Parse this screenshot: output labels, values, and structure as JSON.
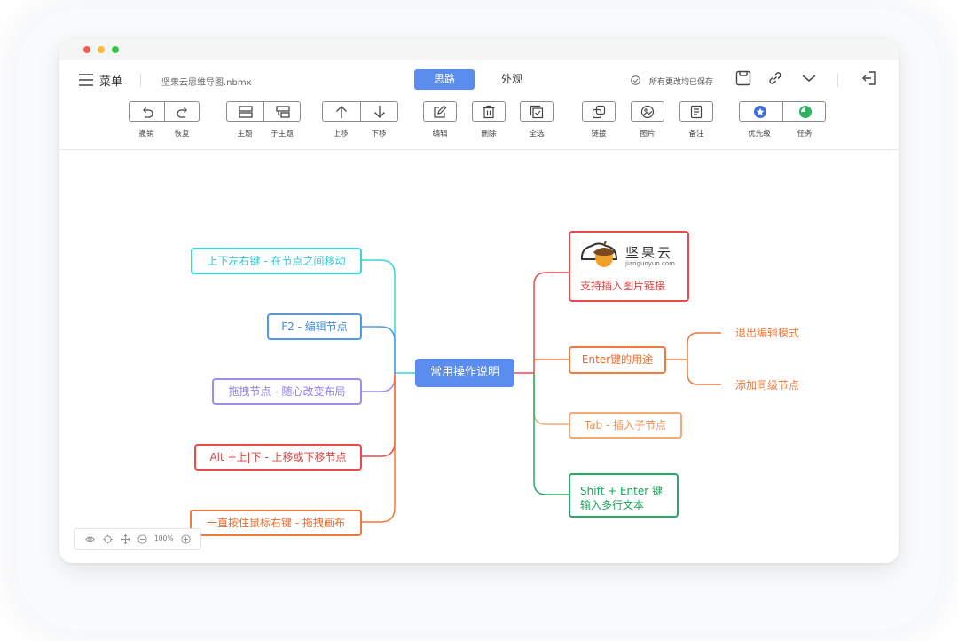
{
  "header": {
    "menu_label": "菜单",
    "file_name": "坚果云思维导图.nbmx",
    "tabs": [
      {
        "label": "思路",
        "active": true
      },
      {
        "label": "外观",
        "active": false
      }
    ],
    "save_status": "所有更改均已保存"
  },
  "toolbar": {
    "undo": "撤销",
    "redo": "恢复",
    "topic": "主题",
    "subtopic": "子主题",
    "move_up": "上移",
    "move_down": "下移",
    "edit": "编辑",
    "delete": "删除",
    "select_all": "全选",
    "link": "链接",
    "image": "图片",
    "note": "备注",
    "priority": "优先级",
    "task": "任务"
  },
  "mindmap": {
    "center": "常用操作说明",
    "left_nodes": [
      "上下左右键 - 在节点之间移动",
      "F2 - 编辑节点",
      "拖拽节点 - 随心改变布局",
      "Alt +上|下 - 上移或下移节点",
      "一直按住鼠标右键 - 拖拽画布"
    ],
    "right_nodes": {
      "image_node": {
        "brand_name": "坚果云",
        "brand_url": "jianguoyun.com",
        "caption": "支持插入图片链接"
      },
      "enter_node": "Enter键的用途",
      "enter_children": [
        "退出编辑模式",
        "添加同级节点"
      ],
      "tab_node": "Tab - 插入子节点",
      "shift_node_line1": "Shift + Enter 键",
      "shift_node_line2": "输入多行文本"
    }
  },
  "colors": {
    "accent_blue": "#5b8def",
    "cyan": "#3dd3dc",
    "blue": "#4f9ae6",
    "purple": "#9b8ef0",
    "red": "#ea4a4a",
    "orange": "#ef7a3b",
    "light_orange": "#f4a872",
    "green": "#1fae63"
  },
  "zoom": {
    "level": "100%"
  }
}
